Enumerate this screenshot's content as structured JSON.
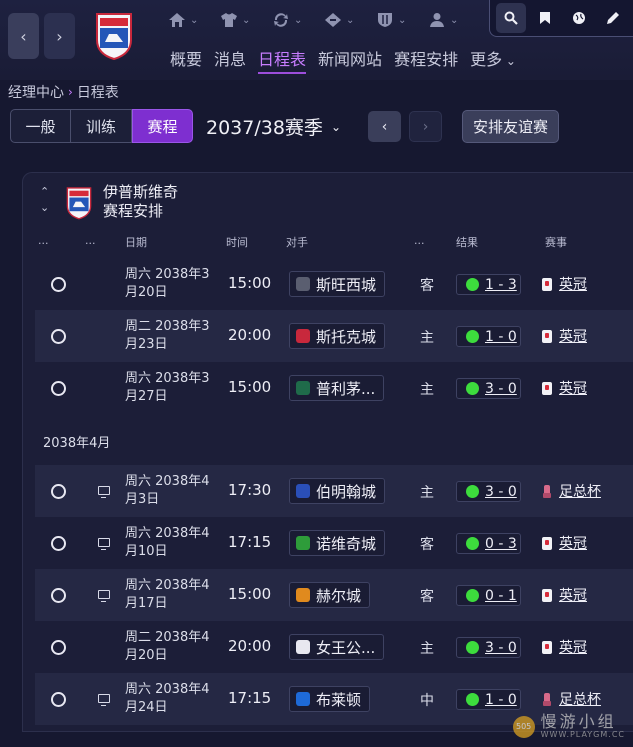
{
  "topbar": {
    "icons": [
      "home-icon",
      "shirt-icon",
      "transfer-icon",
      "tactics-icon",
      "shield-icon",
      "person-icon"
    ],
    "tools": [
      "search-icon",
      "bookmark-icon",
      "globe-icon",
      "pen-icon"
    ],
    "menu": [
      "概要",
      "消息",
      "日程表",
      "新闻网站",
      "赛程安排",
      "更多"
    ],
    "active_menu": "日程表"
  },
  "breadcrumb": {
    "parent": "经理中心",
    "current": "日程表"
  },
  "filters": {
    "tabs": [
      "一般",
      "训练",
      "赛程"
    ],
    "active_tab": "赛程",
    "season": "2037/38赛季",
    "friendly_button": "安排友谊赛"
  },
  "panel": {
    "club_name": "伊普斯维奇",
    "subtitle": "赛程安排",
    "headers": {
      "c1": "...",
      "c2": "...",
      "date": "日期",
      "time": "时间",
      "opponent": "对手",
      "venue": "...",
      "result": "结果",
      "competition": "赛事"
    }
  },
  "month_label": "2038年4月",
  "fixtures": [
    {
      "date": "周六 2038年3月20日",
      "time": "15:00",
      "opponent": "斯旺西城",
      "badge_color": "#5a5e70",
      "venue": "客",
      "result": "1 - 3",
      "competition": "英冠",
      "comp_icon": "league-icon",
      "tv": false
    },
    {
      "date": "周二 2038年3月23日",
      "time": "20:00",
      "opponent": "斯托克城",
      "badge_color": "#c8283c",
      "venue": "主",
      "result": "1 - 0",
      "competition": "英冠",
      "comp_icon": "league-icon",
      "tv": false
    },
    {
      "date": "周六 2038年3月27日",
      "time": "15:00",
      "opponent": "普利茅...",
      "badge_color": "#1f6b4a",
      "venue": "主",
      "result": "3 - 0",
      "competition": "英冠",
      "comp_icon": "league-icon",
      "tv": false
    },
    {
      "date": "周六 2038年4月3日",
      "time": "17:30",
      "opponent": "伯明翰城",
      "badge_color": "#2a4fb8",
      "venue": "主",
      "result": "3 - 0",
      "competition": "足总杯",
      "comp_icon": "cup-icon",
      "tv": true
    },
    {
      "date": "周六 2038年4月10日",
      "time": "17:15",
      "opponent": "诺维奇城",
      "badge_color": "#2e9c3a",
      "venue": "客",
      "result": "0 - 3",
      "competition": "英冠",
      "comp_icon": "league-icon",
      "tv": true
    },
    {
      "date": "周六 2038年4月17日",
      "time": "15:00",
      "opponent": "赫尔城",
      "badge_color": "#e08a1e",
      "venue": "客",
      "result": "0 - 1",
      "competition": "英冠",
      "comp_icon": "league-icon",
      "tv": true
    },
    {
      "date": "周二 2038年4月20日",
      "time": "20:00",
      "opponent": "女王公...",
      "badge_color": "#e8e8f0",
      "venue": "主",
      "result": "3 - 0",
      "competition": "英冠",
      "comp_icon": "league-icon",
      "tv": false
    },
    {
      "date": "周六 2038年4月24日",
      "time": "17:15",
      "opponent": "布莱顿",
      "badge_color": "#1e6ad8",
      "venue": "中",
      "result": "1 - 0",
      "competition": "足总杯",
      "comp_icon": "cup-icon",
      "tv": true
    }
  ],
  "watermark": {
    "text": "慢游小组",
    "site": "WWW.PLAYGM.CC",
    "badge": "505"
  }
}
